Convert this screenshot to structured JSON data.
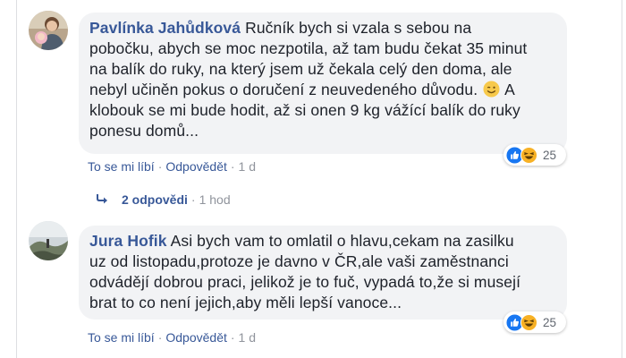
{
  "comments": [
    {
      "author": "Pavlínka Jahůdková",
      "lines": [
        "Ručník bych si vzala s sebou na",
        "pobočku, abych se moc nezpotila, až tam budu čekat 35 minut",
        "na balík do ruky, na který jsem už čekala celý den doma, ale",
        "nebyl učiněn pokus o doručení z neuvedeného důvodu.",
        "A",
        "klobouk se mi bude hodit, až si onen 9 kg vážící balík do ruky",
        "ponesu domů..."
      ],
      "emoji_inline": "smile-emoji-icon",
      "reaction_icons": [
        "like-icon",
        "haha-icon"
      ],
      "reaction_count": "25",
      "actions": {
        "like": "To se mi líbí",
        "reply": "Odpovědět",
        "time": "1 d"
      }
    },
    {
      "author": "Jura Hofik",
      "lines": [
        "Asi bych vam to omlatil o hlavu,cekam na zasilku",
        "uz od listopadu,protoze je davno v ČR,ale vaši zaměstnanci",
        "odvádějí dobrou praci, jelikož je to fuč, vypadá to,že si musejí",
        "brat to co není jejich,aby měli lepší vanoce..."
      ],
      "reaction_icons": [
        "like-icon",
        "haha-icon"
      ],
      "reaction_count": "25",
      "actions": {
        "like": "To se mi líbí",
        "reply": "Odpovědět",
        "time": "1 d"
      }
    }
  ],
  "replies": {
    "icon": "reply-arrow-icon",
    "label": "2 odpovědi",
    "time": "1 hod"
  },
  "separator": "·",
  "colors": {
    "link": "#385898",
    "bubble": "#f2f3f5",
    "meta": "#90949c",
    "like": "#1877f2",
    "haha": "#f7b125"
  }
}
